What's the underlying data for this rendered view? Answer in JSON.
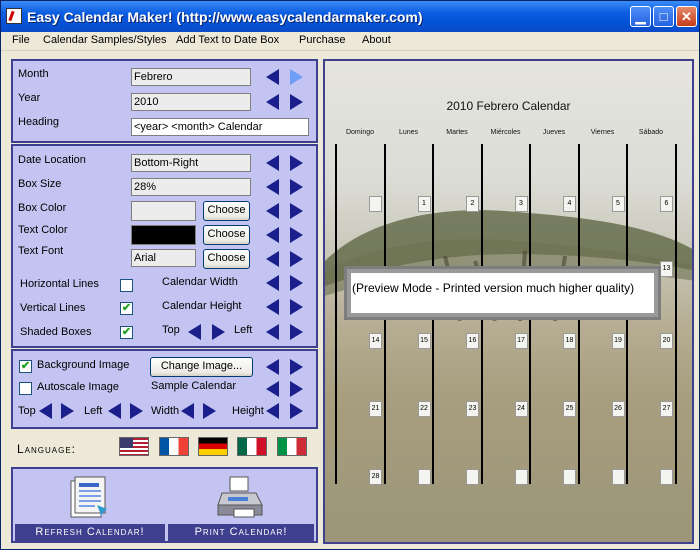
{
  "window": {
    "title": "Easy Calendar Maker! (http://www.easycalendarmaker.com)"
  },
  "menu": [
    {
      "label": "File"
    },
    {
      "label": "Calendar Samples/Styles"
    },
    {
      "label": "Add Text to Date Box"
    },
    {
      "label": "Purchase"
    },
    {
      "label": "About"
    }
  ],
  "settings": {
    "month_label": "Month",
    "month_value": "Febrero",
    "year_label": "Year",
    "year_value": "2010",
    "heading_label": "Heading",
    "heading_value": "<year> <month> Calendar"
  },
  "format": {
    "date_location_label": "Date Location",
    "date_location_value": "Bottom-Right",
    "box_size_label": "Box Size",
    "box_size_value": "28%",
    "box_color_label": "Box Color",
    "text_color_label": "Text Color",
    "text_font_label": "Text Font",
    "text_font_value": "Arial",
    "choose_label": "Choose",
    "horizontal_lines_label": "Horizontal Lines",
    "horizontal_lines_checked": false,
    "vertical_lines_label": "Vertical Lines",
    "vertical_lines_checked": true,
    "shaded_boxes_label": "Shaded Boxes",
    "shaded_boxes_checked": true,
    "calendar_width_label": "Calendar Width",
    "calendar_height_label": "Calendar Height",
    "top_label": "Top",
    "left_label": "Left",
    "box_color": "#ececec",
    "text_color": "#000000"
  },
  "background": {
    "background_image_label": "Background Image",
    "background_image_checked": true,
    "change_image_label": "Change Image...",
    "autoscale_label": "Autoscale Image",
    "autoscale_checked": false,
    "sample_calendar_label": "Sample Calendar",
    "top_label": "Top",
    "left_label": "Left",
    "width_label": "Width",
    "height_label": "Height"
  },
  "language": {
    "label": "Language:",
    "flags": [
      "us-flag",
      "france-flag",
      "germany-flag",
      "mexico-flag",
      "italy-flag"
    ]
  },
  "actions": {
    "refresh_label": "Refresh Calendar!",
    "print_label": "Print Calendar!"
  },
  "preview": {
    "title": "2010 Febrero Calendar",
    "days": [
      "Domingo",
      "Lunes",
      "Martes",
      "Miércoles",
      "Jueves",
      "Viernes",
      "Sábado"
    ],
    "weeks": [
      [
        "",
        "1",
        "2",
        "3",
        "4",
        "5",
        "6"
      ],
      [
        "",
        "",
        "",
        "",
        "",
        "",
        "13"
      ],
      [
        "14",
        "15",
        "16",
        "17",
        "18",
        "19",
        "20"
      ],
      [
        "21",
        "22",
        "23",
        "24",
        "25",
        "26",
        "27"
      ],
      [
        "28",
        "",
        "",
        "",
        "",
        "",
        ""
      ]
    ],
    "overlay_text": "(Preview Mode - Printed version much higher quality)"
  },
  "colors": {
    "panel": "#c4c4f2",
    "panel_border": "#3f3f8f",
    "arrow": "#1a1f8c",
    "titlebar": "#0453d6"
  }
}
